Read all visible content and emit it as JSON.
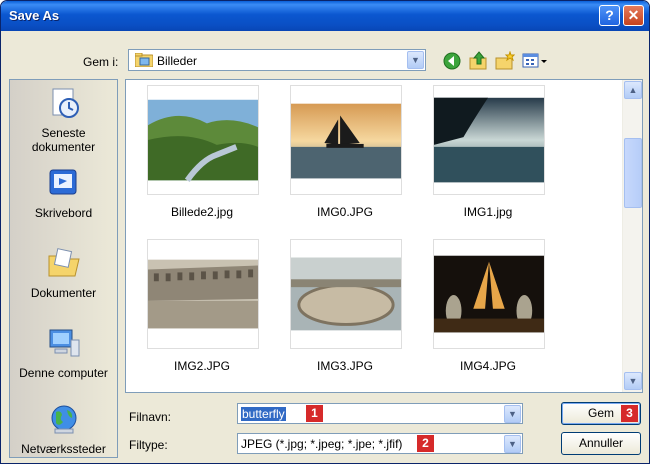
{
  "window": {
    "title": "Save As",
    "help_symbol": "?",
    "close_symbol": "✕"
  },
  "look_in": {
    "label": "Gem i:",
    "value": "Billeder"
  },
  "toolbar": {
    "icons": [
      "back-icon",
      "up-folder-icon",
      "new-folder-icon",
      "view-menu-icon"
    ]
  },
  "places": [
    {
      "label": "Seneste dokumenter",
      "icon": "recent-documents-icon"
    },
    {
      "label": "Skrivebord",
      "icon": "desktop-icon"
    },
    {
      "label": "Dokumenter",
      "icon": "my-documents-icon"
    },
    {
      "label": "Denne computer",
      "icon": "my-computer-icon"
    },
    {
      "label": "Netværkssteder",
      "icon": "network-places-icon"
    }
  ],
  "files": [
    {
      "name": "Billede2.jpg",
      "subject": "river-valley"
    },
    {
      "name": "IMG0.JPG",
      "subject": "sailboat-sunset"
    },
    {
      "name": "IMG1.jpg",
      "subject": "coastal-cliffs"
    },
    {
      "name": "IMG2.JPG",
      "subject": "colosseum"
    },
    {
      "name": "IMG3.JPG",
      "subject": "st-peters-square"
    },
    {
      "name": "IMG4.JPG",
      "subject": "eiffel-tower-night"
    }
  ],
  "filename": {
    "label": "Filnavn:",
    "value": "butterfly",
    "badge": "1"
  },
  "filetype": {
    "label": "Filtype:",
    "value": "JPEG (*.jpg; *.jpeg; *.jpe; *.jfif)",
    "badge": "2"
  },
  "buttons": {
    "save": "Gem",
    "save_badge": "3",
    "cancel": "Annuller"
  },
  "colors": {
    "titlebar": "#0a4fc4",
    "badge": "#d62a2a",
    "selection": "#316ac5"
  }
}
